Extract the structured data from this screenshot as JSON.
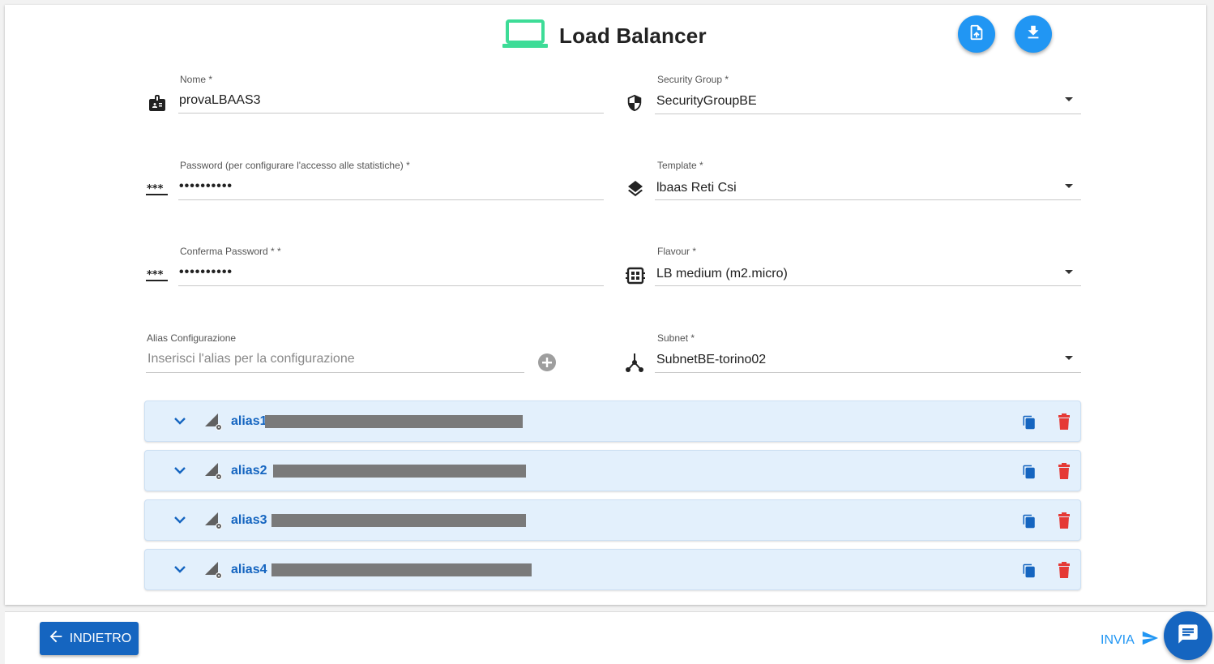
{
  "header": {
    "title": "Load Balancer",
    "icon": "laptop-icon",
    "upload_icon": "file-upload-icon",
    "download_icon": "download-icon"
  },
  "form": {
    "nome": {
      "label": "Nome *",
      "value": "provaLBAAS3",
      "icon": "badge-icon"
    },
    "password": {
      "label": "Password (per configurare l'accesso alle statistiche) *",
      "value": "••••••••••",
      "icon": "password-icon"
    },
    "conferma_password": {
      "label": "Conferma Password * *",
      "value": "••••••••••",
      "icon": "password-icon"
    },
    "alias": {
      "label": "Alias Configurazione",
      "placeholder": "Inserisci l'alias per la configurazione",
      "add_icon": "add-circle-icon"
    },
    "security_group": {
      "label": "Security Group *",
      "value": "SecurityGroupBE",
      "icon": "shield-icon"
    },
    "template": {
      "label": "Template *",
      "value": "lbaas Reti Csi",
      "icon": "layers-icon"
    },
    "flavour": {
      "label": "Flavour *",
      "value": "LB medium (m2.micro)",
      "icon": "memory-chip-icon"
    },
    "subnet": {
      "label": "Subnet *",
      "value": "SubnetBE-torino02",
      "icon": "network-icon"
    }
  },
  "aliases": [
    {
      "name": "alias1"
    },
    {
      "name": "alias2"
    },
    {
      "name": "alias3"
    },
    {
      "name": "alias4"
    }
  ],
  "footer": {
    "back_label": "INDIETRO",
    "send_label": "INVIA",
    "chat_icon": "chat-icon"
  },
  "colors": {
    "primary": "#1565c0",
    "accent": "#2196f3",
    "laptop": "#3ddc97",
    "delete": "#e53935",
    "alias_bg": "#e3f0fc"
  }
}
